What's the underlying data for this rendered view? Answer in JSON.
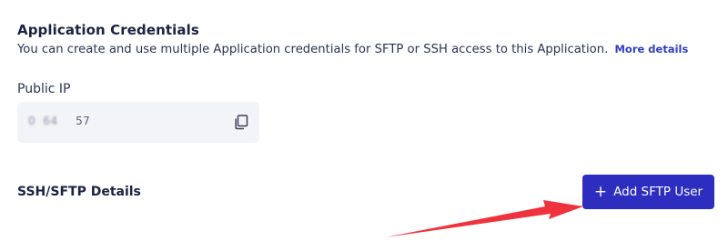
{
  "credentials": {
    "title": "Application Credentials",
    "description": "You can create and use multiple Application credentials for SFTP or SSH access to this Application.",
    "more_link": "More details"
  },
  "public_ip": {
    "label": "Public IP",
    "value_masked": "0   64       ",
    "value_visible_suffix": "57"
  },
  "ssh": {
    "title": "SSH/SFTP Details",
    "add_button_label": "Add SFTP User",
    "add_button_icon": "plus-icon"
  },
  "colors": {
    "button_bg": "#2d2dbf",
    "link": "#2f3fbf",
    "arrow": "#f0323c",
    "ip_box_bg": "#f3f4f7"
  }
}
